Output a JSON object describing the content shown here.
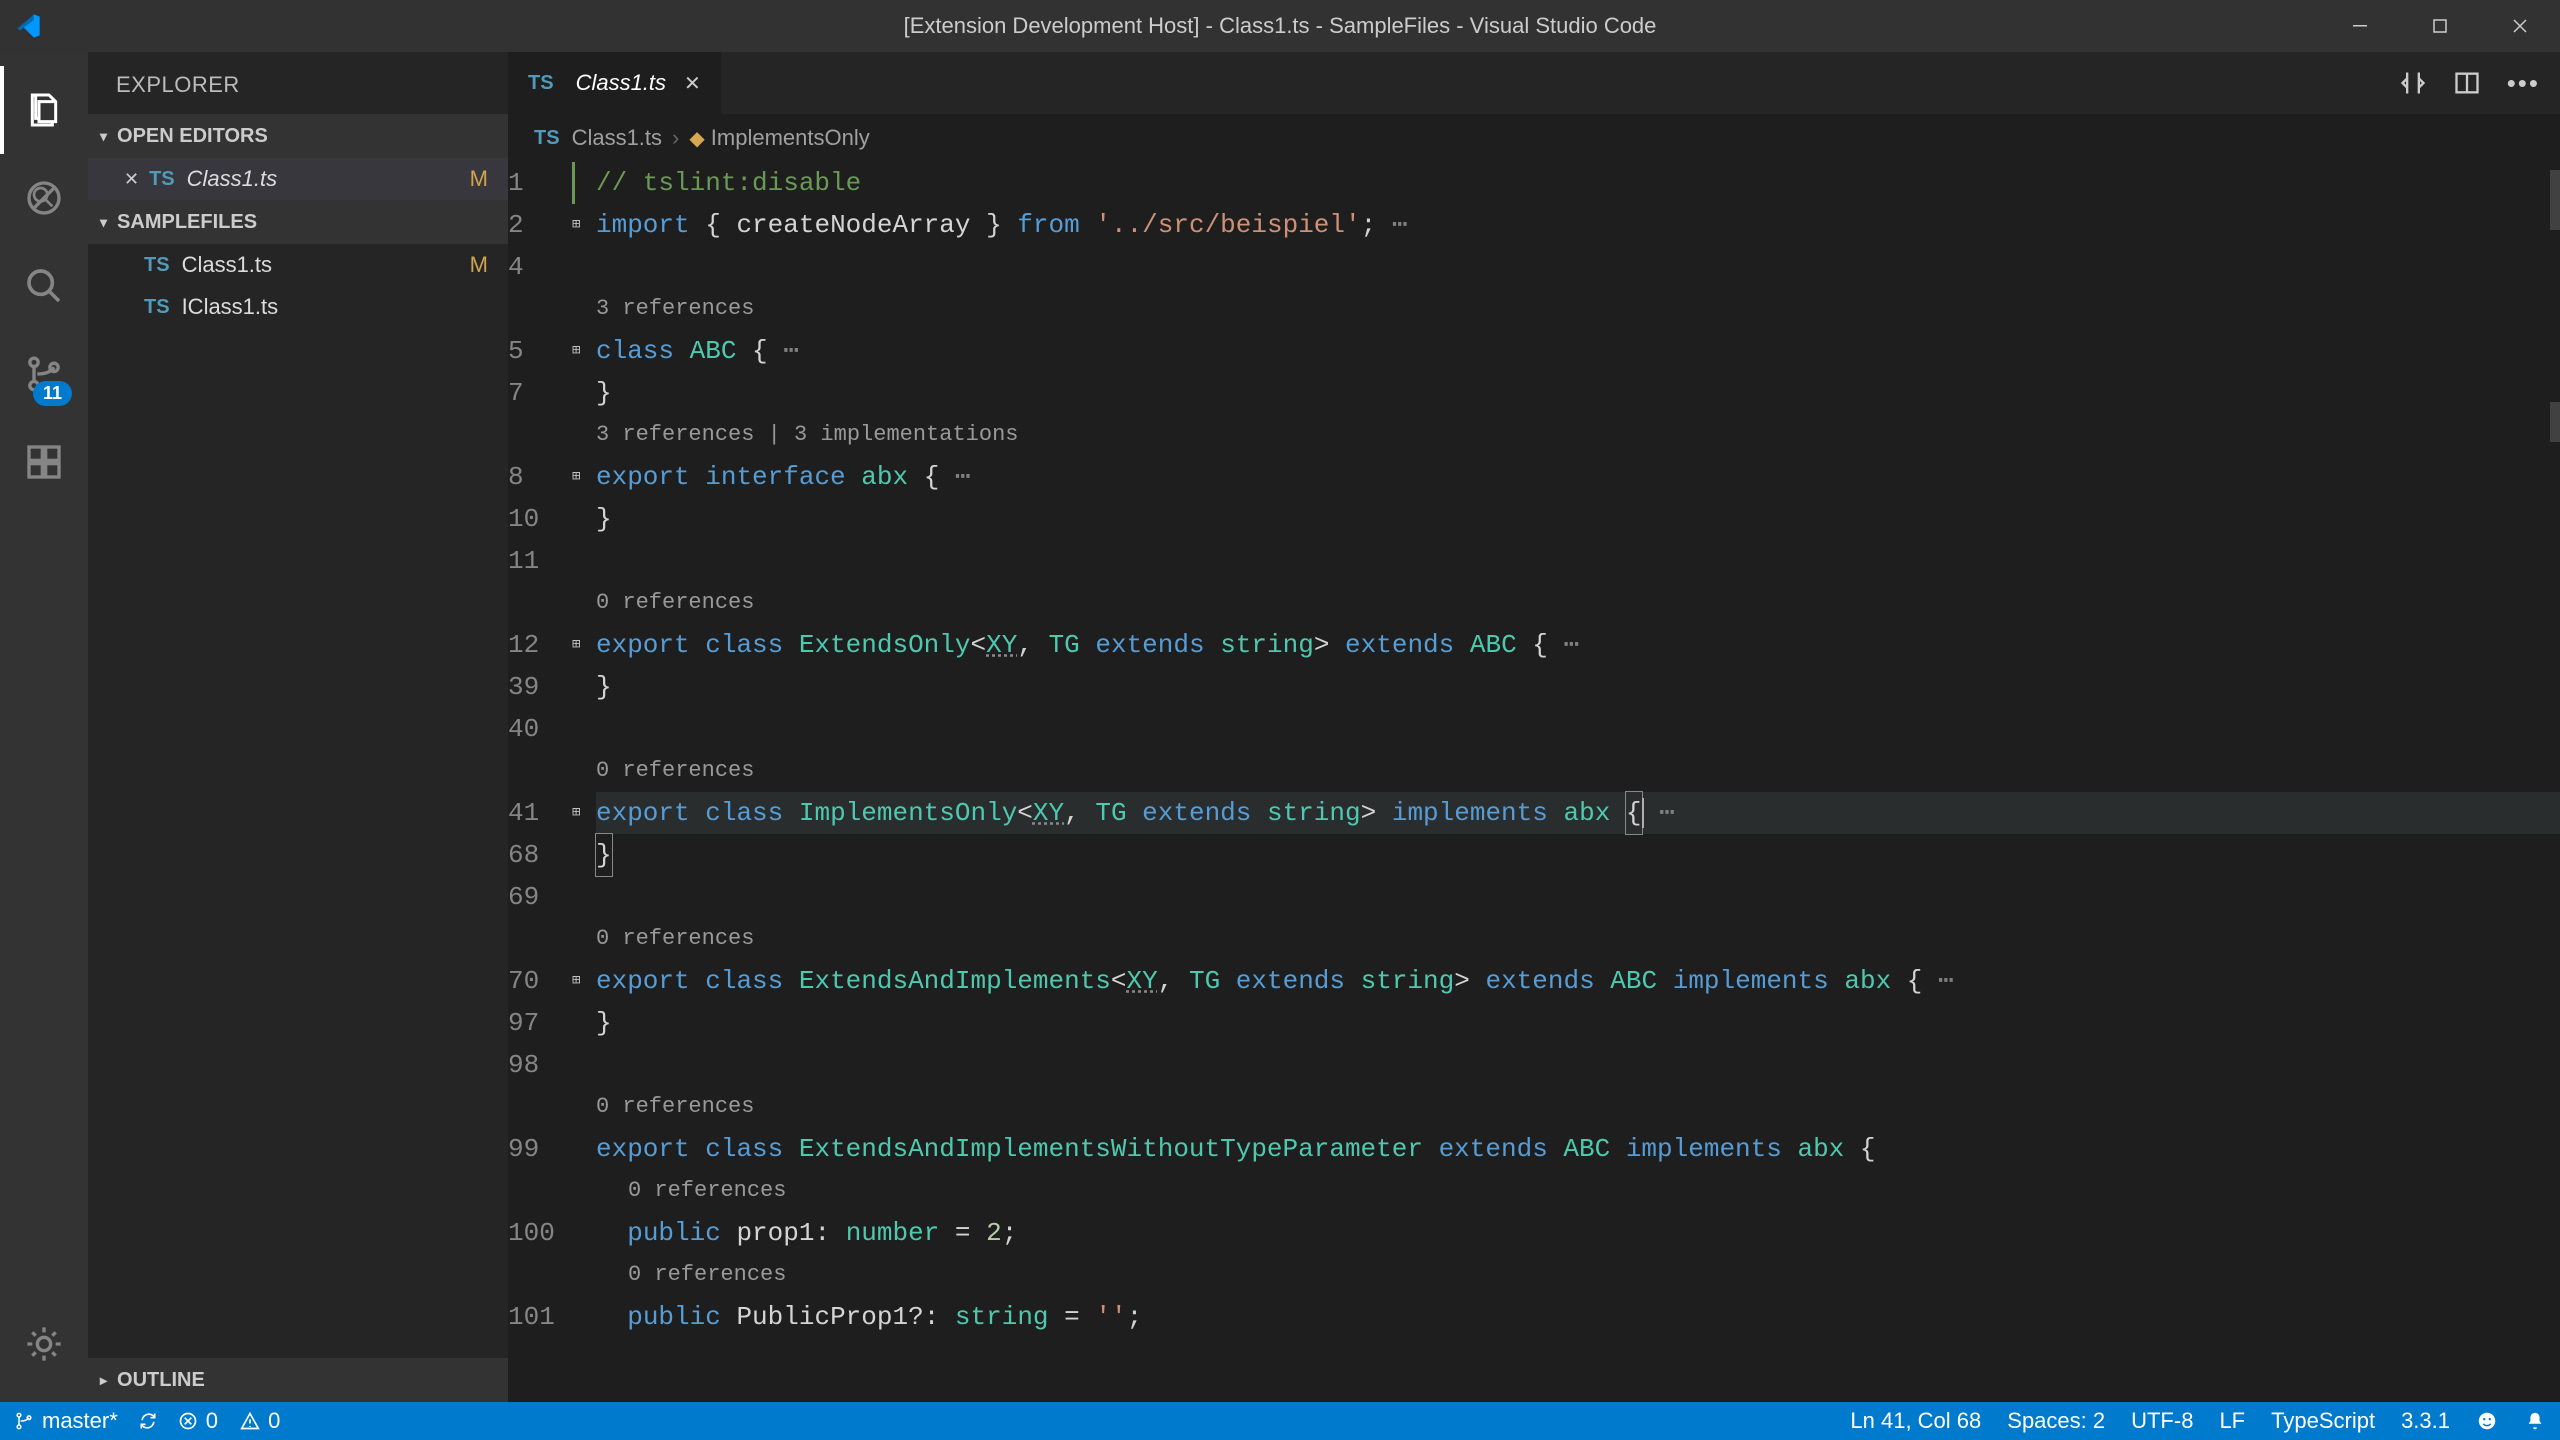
{
  "titlebar": {
    "title": "[Extension Development Host] - Class1.ts - SampleFiles - Visual Studio Code"
  },
  "activitybar": {
    "scm_badge": "11"
  },
  "sidebar": {
    "title": "EXPLORER",
    "sections": {
      "open_editors": "OPEN EDITORS",
      "workspace": "SAMPLEFILES",
      "outline": "OUTLINE"
    },
    "open_editors_items": [
      {
        "name": "Class1.ts",
        "modified": "M",
        "active": true
      }
    ],
    "workspace_items": [
      {
        "name": "Class1.ts",
        "modified": "M"
      },
      {
        "name": "IClass1.ts",
        "modified": ""
      }
    ]
  },
  "tabs": {
    "items": [
      {
        "label": "Class1.ts"
      }
    ]
  },
  "breadcrumb": {
    "file": "Class1.ts",
    "symbol": "ImplementsOnly"
  },
  "editor": {
    "lens_3refs": "3 references",
    "lens_3refs_3impl": "3 references | 3 implementations",
    "lens_0refs": "0 references",
    "lines": {
      "l1_comment": "// tslint:disable",
      "l2_import": "import",
      "l2_from": "from",
      "l2_braces_open": "{",
      "l2_ident": "createNodeArray",
      "l2_braces_close": "}",
      "l2_path": "'../src/beispiel'",
      "l2_semi": ";",
      "l5_class": "class",
      "l5_name": "ABC",
      "l5_brace": "{",
      "l7_brace": "}",
      "l8_export": "export",
      "l8_interface": "interface",
      "l8_name": "abx",
      "l8_brace": "{",
      "l10_brace": "}",
      "l12_export": "export",
      "l12_class": "class",
      "l12_name": "ExtendsOnly",
      "l12_gen_open": "<",
      "l12_xy": "XY",
      "l12_comma": ",",
      "l12_tg": "TG",
      "l12_extends_kw": "extends",
      "l12_string": "string",
      "l12_gen_close": ">",
      "l12_extends2": "extends",
      "l12_abc": "ABC",
      "l12_brace": "{",
      "l39_brace": "}",
      "l41_export": "export",
      "l41_class": "class",
      "l41_name": "ImplementsOnly",
      "l41_xy": "XY",
      "l41_tg": "TG",
      "l41_extends": "extends",
      "l41_string": "string",
      "l41_implements": "implements",
      "l41_abx": "abx",
      "l41_brace": "{",
      "l68_brace": "}",
      "l70_export": "export",
      "l70_class": "class",
      "l70_name": "ExtendsAndImplements",
      "l70_xy": "XY",
      "l70_tg": "TG",
      "l70_ext": "extends",
      "l70_string": "string",
      "l70_ext2": "extends",
      "l70_abc": "ABC",
      "l70_impl": "implements",
      "l70_abx": "abx",
      "l70_brace": "{",
      "l97_brace": "}",
      "l99_export": "export",
      "l99_class": "class",
      "l99_name": "ExtendsAndImplementsWithoutTypeParameter",
      "l99_ext": "extends",
      "l99_abc": "ABC",
      "l99_impl": "implements",
      "l99_abx": "abx",
      "l99_brace": "{",
      "l100_public": "public",
      "l100_prop": "prop1",
      "l100_colon": ":",
      "l100_type": "number",
      "l100_eq": "=",
      "l100_val": "2",
      "l100_semi": ";",
      "l101_public": "public",
      "l101_prop": "PublicProp1?",
      "l101_colon": ":",
      "l101_type": "string",
      "l101_eq": "=",
      "l101_val": "''",
      "l101_semi": ";"
    },
    "line_numbers": {
      "n1": "1",
      "n2": "2",
      "n4": "4",
      "n5": "5",
      "n7": "7",
      "n8": "8",
      "n10": "10",
      "n11": "11",
      "n12": "12",
      "n39": "39",
      "n40": "40",
      "n41": "41",
      "n68": "68",
      "n69": "69",
      "n70": "70",
      "n97": "97",
      "n98": "98",
      "n99": "99",
      "n100": "100",
      "n101": "101"
    }
  },
  "statusbar": {
    "branch": "master*",
    "errors": "0",
    "warnings": "0",
    "cursor": "Ln 41, Col 68",
    "spaces": "Spaces: 2",
    "encoding": "UTF-8",
    "eol": "LF",
    "lang": "TypeScript",
    "tsver": "3.3.1"
  }
}
